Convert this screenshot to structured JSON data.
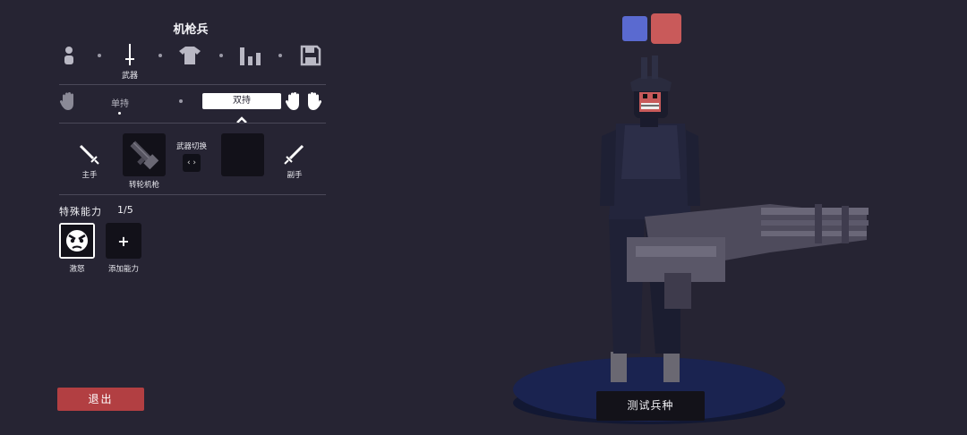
{
  "unit_name": "机枪兵",
  "categories": [
    {
      "icon": "person-icon"
    },
    {
      "icon": "sword-icon",
      "label": "武器"
    },
    {
      "icon": "shirt-icon"
    },
    {
      "icon": "stats-icon"
    },
    {
      "icon": "save-icon"
    }
  ],
  "grip": {
    "single_label": "单持",
    "dual_label": "双持",
    "selected": "双持"
  },
  "weapons": {
    "main_hand_label": "主手",
    "main_weapon_name": "转轮机枪",
    "switch_label": "武器切换",
    "switch_symbol": "‹ ›",
    "off_hand_label": "副手"
  },
  "abilities": {
    "title": "特殊能力",
    "count": "1/5",
    "items": [
      {
        "label": "激怒",
        "icon": "angry-face-icon"
      },
      {
        "label": "添加能力",
        "icon": "plus-icon",
        "symbol": "+"
      }
    ]
  },
  "exit_label": "退出",
  "test_label": "测试兵种",
  "colors": {
    "background": "#262433",
    "exit_button": "#b23f42",
    "team_blue": "#5a6ad0",
    "team_red": "#c95a5a",
    "platform": "#1a2350"
  }
}
